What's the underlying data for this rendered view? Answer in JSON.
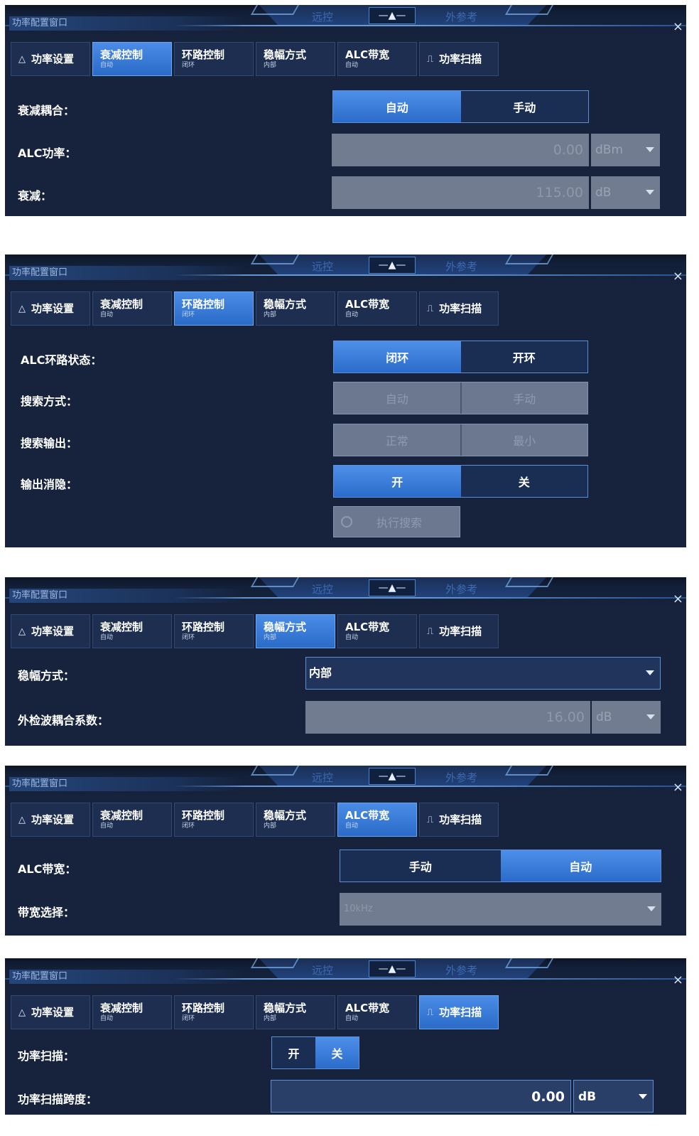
{
  "window": {
    "title": "功率配置窗口",
    "center_left": "远控",
    "center_right": "外参考",
    "home_icon": "home-icon",
    "close_glyph": "×"
  },
  "tabs": [
    {
      "label": "功率设置",
      "sub": "",
      "icon": "triangle-icon"
    },
    {
      "label": "衰减控制",
      "sub": "自动"
    },
    {
      "label": "环路控制",
      "sub": "闭环"
    },
    {
      "label": "稳幅方式",
      "sub": "内部"
    },
    {
      "label": "ALC带宽",
      "sub": "自动"
    },
    {
      "label": "功率扫描",
      "sub": "",
      "icon": "step-icon"
    }
  ],
  "panel1": {
    "atten_coupling": {
      "label": "衰减耦合：",
      "options": [
        "自动",
        "手动"
      ],
      "selected": "自动"
    },
    "alc_power": {
      "label": "ALC功率：",
      "value": "0.00",
      "unit": "dBm"
    },
    "attenuation": {
      "label": "衰减：",
      "value": "115.00",
      "unit": "dB"
    }
  },
  "panel2": {
    "loop_state": {
      "label": "ALC环路状态：",
      "options": [
        "闭环",
        "开环"
      ],
      "selected": "闭环"
    },
    "search_mode": {
      "label": "搜索方式：",
      "options": [
        "自动",
        "手动"
      ]
    },
    "search_output": {
      "label": "搜索输出：",
      "options": [
        "正常",
        "最小"
      ]
    },
    "output_blanking": {
      "label": "输出消隐：",
      "options": [
        "开",
        "关"
      ],
      "selected": "开"
    },
    "execute_search": {
      "label": "执行搜索"
    }
  },
  "panel3": {
    "leveling_mode": {
      "label": "稳幅方式：",
      "value": "内部"
    },
    "ext_coupling": {
      "label": "外检波耦合系数：",
      "value": "16.00",
      "unit": "dB"
    }
  },
  "panel4": {
    "alc_bandwidth": {
      "label": "ALC带宽：",
      "options": [
        "手动",
        "自动"
      ],
      "selected": "自动"
    },
    "bw_select": {
      "label": "带宽选择：",
      "value": "10kHz"
    }
  },
  "panel5": {
    "power_sweep": {
      "label": "功率扫描：",
      "options": [
        "开",
        "关"
      ],
      "selected": "关"
    },
    "sweep_span": {
      "label": "功率扫描跨度：",
      "value": "0.00",
      "unit": "dB"
    }
  },
  "colors": {
    "panel_bg": "#17233d",
    "accent": "#3a7ddb",
    "disabled": "#727c90"
  }
}
